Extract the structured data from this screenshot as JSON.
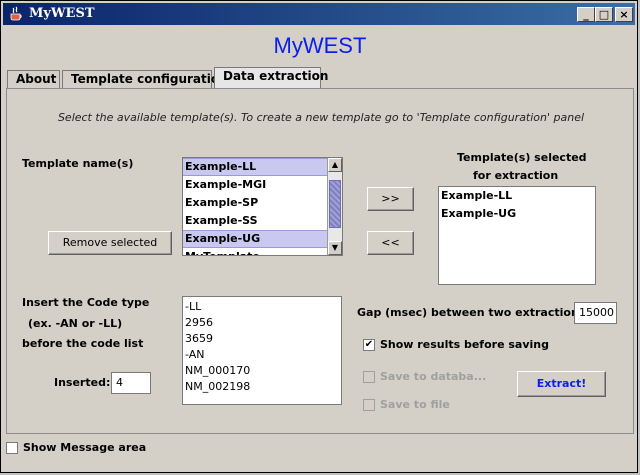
{
  "window": {
    "title": "MyWEST"
  },
  "controls": {
    "minimize": "_",
    "maximize": "□",
    "close": "×"
  },
  "app_title": "MyWEST",
  "tabs": [
    {
      "label": "About"
    },
    {
      "label": "Template configuration"
    },
    {
      "label": "Data extraction"
    }
  ],
  "panel": {
    "instruction": "Select the available template(s). To create a new template go to 'Template configuration' panel",
    "template_names_label": "Template name(s)",
    "template_list": [
      {
        "label": "Example-LL"
      },
      {
        "label": "Example-MGI"
      },
      {
        "label": "Example-SP"
      },
      {
        "label": "Example-SS"
      },
      {
        "label": "Example-UG"
      },
      {
        "label": "MyTemplate"
      }
    ],
    "remove_button": "Remove selected",
    "add_button": ">>",
    "remove_arrow_button": "<<",
    "selected_label_line1": "Template(s)  selected",
    "selected_label_line2": "for extraction",
    "selected_list": [
      {
        "label": "Example-LL"
      },
      {
        "label": "Example-UG"
      }
    ],
    "code_label_line1": "Insert the Code type",
    "code_label_line2": "(ex. -AN or -LL)",
    "code_label_line3": "before the code list",
    "code_list": [
      {
        "label": "-LL"
      },
      {
        "label": "2956"
      },
      {
        "label": "3659"
      },
      {
        "label": "-AN"
      },
      {
        "label": "NM_000170"
      },
      {
        "label": "NM_002198"
      }
    ],
    "inserted_label": "Inserted:",
    "inserted_value": "4",
    "gap_label": "Gap (msec) between two extractions:",
    "gap_value": "15000",
    "show_results_label": "Show results before saving",
    "show_results_checked": true,
    "save_db_label": "Save to databa...",
    "save_file_label": "Save to file",
    "extract_button": "Extract!"
  },
  "status": {
    "show_message_label": "Show Message area"
  },
  "colors": {
    "accent": "#0b1fe8",
    "titlebar": "#0a246a",
    "selection": "#c8c8f0"
  }
}
